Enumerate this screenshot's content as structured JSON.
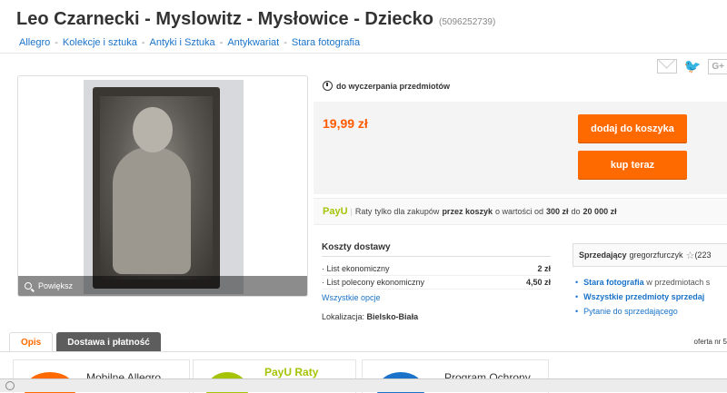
{
  "title": "Leo Czarnecki - Myslowitz - Mysłowice - Dziecko",
  "offer_id": "(5096252739)",
  "breadcrumbs": [
    "Allegro",
    "Kolekcje i sztuka",
    "Antyki i Sztuka",
    "Antykwariat",
    "Stara fotografia"
  ],
  "share": {
    "twitter": "twitter-icon",
    "gplus": "G+"
  },
  "gallery": {
    "zoom_label": "Powiększ"
  },
  "quantity": "do wyczerpania przedmiotów",
  "price": "19,99 zł",
  "buttons": {
    "add_to_cart": "dodaj do koszyka",
    "buy_now": "kup teraz"
  },
  "payu": {
    "logo": "PayU",
    "sep": "|",
    "raty": "Raty",
    "text1": "tylko dla zakupów",
    "bold1": "przez koszyk",
    "text2": "o wartości od",
    "min": "300 zł",
    "text3": "do",
    "max": "20 000 zł"
  },
  "shipping": {
    "heading": "Koszty dostawy",
    "rows": [
      {
        "label": "List ekonomiczny",
        "value": "2 zł"
      },
      {
        "label": "List polecony ekonomiczny",
        "value": "4,50 zł"
      }
    ],
    "all_options": "Wszystkie opcje"
  },
  "location": {
    "label": "Lokalizacja:",
    "value": "Bielsko-Biała"
  },
  "seller": {
    "label": "Sprzedający",
    "name": "gregorzfurczyk",
    "rating": "(223",
    "links": [
      {
        "a": "Stara fotografia",
        "b": "w przedmiotach s"
      },
      {
        "a": "Wszystkie przedmioty sprzedaj",
        "b": ""
      },
      {
        "a": "Pytanie do sprzedającego",
        "b": ""
      }
    ]
  },
  "tabs": [
    "Opis",
    "Dostawa i płatność"
  ],
  "offer_nr": "oferta nr 5",
  "promo": [
    "Mobilne Allegro",
    "PayU Raty",
    "Program Ochrony"
  ]
}
